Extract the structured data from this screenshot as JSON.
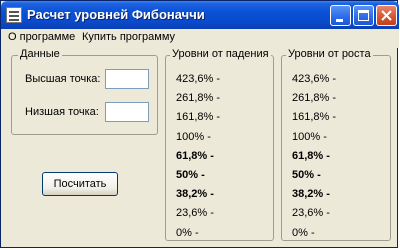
{
  "window": {
    "title": "Расчет уровней Фибоначчи"
  },
  "menu": {
    "items": [
      "О программе",
      "Купить программу"
    ]
  },
  "data_group": {
    "title": "Данные",
    "high_label": "Высшая точка:",
    "high_value": "",
    "low_label": "Низшая точка:",
    "low_value": ""
  },
  "calc_button": {
    "label": "Посчитать"
  },
  "falling_group": {
    "title": "Уровни от падения",
    "levels": [
      {
        "text": "423,6% -",
        "bold": false
      },
      {
        "text": "261,8% -",
        "bold": false
      },
      {
        "text": "161,8% -",
        "bold": false
      },
      {
        "text": "100% -",
        "bold": false
      },
      {
        "text": "61,8% -",
        "bold": true
      },
      {
        "text": "50% -",
        "bold": true
      },
      {
        "text": "38,2% -",
        "bold": true
      },
      {
        "text": "23,6% -",
        "bold": false
      },
      {
        "text": "0% -",
        "bold": false
      }
    ]
  },
  "rising_group": {
    "title": "Уровни от роста",
    "levels": [
      {
        "text": "423,6% -",
        "bold": false
      },
      {
        "text": "261,8% -",
        "bold": false
      },
      {
        "text": "161,8% -",
        "bold": false
      },
      {
        "text": "100% -",
        "bold": false
      },
      {
        "text": "61,8% -",
        "bold": true
      },
      {
        "text": "50% -",
        "bold": true
      },
      {
        "text": "38,2% -",
        "bold": true
      },
      {
        "text": "23,6% -",
        "bold": false
      },
      {
        "text": "0% -",
        "bold": false
      }
    ]
  },
  "icons": {
    "app": "app-window-icon",
    "minimize": "minimize-icon",
    "maximize": "maximize-icon",
    "close": "close-icon"
  }
}
